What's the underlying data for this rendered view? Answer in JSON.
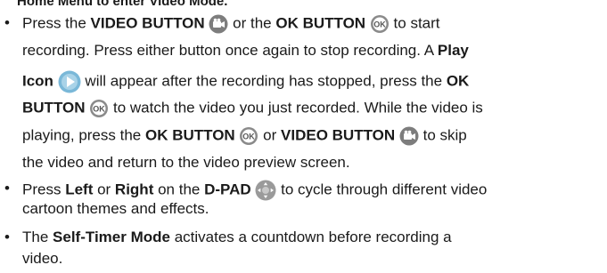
{
  "heading": "Home Menu to enter Video Mode.",
  "icons": {
    "video_button": "video-camera-icon",
    "ok_button": "ok-button-icon",
    "play": "play-icon",
    "dpad": "d-pad-icon"
  },
  "colors": {
    "video_icon_bg": "#7d7d7d",
    "ok_icon_ring": "#8a8a8a",
    "play_icon": "#7ab8d8",
    "dpad_icon": "#9a9a9a"
  },
  "bullet1": {
    "l1a": "Press the ",
    "l1b": "VIDEO BUTTON",
    "l1c": " or the ",
    "l1d": "OK BUTTON",
    "l1e": " to start",
    "l2": "recording. Press either button once again to stop recording. A ",
    "l2b": "Play",
    "l3a": "Icon",
    "l3b": " will appear after the recording has stopped, press the ",
    "l3c": "OK",
    "l4a": "BUTTON",
    "l4b": " to watch the video you just recorded. While the video is",
    "l5a": "playing, press the ",
    "l5b": "OK BUTTON",
    "l5c": " or ",
    "l5d": "VIDEO BUTTON",
    "l5e": " to skip",
    "l6": "the video and return to the video preview screen."
  },
  "bullet2": {
    "l1a": "Press ",
    "l1b": "Left",
    "l1c": " or ",
    "l1d": "Right",
    "l1e": " on the ",
    "l1f": "D-PAD",
    "l1g": " to cycle through different video",
    "l2": "cartoon themes and effects."
  },
  "bullet3": {
    "l1a": "The ",
    "l1b": "Self-Timer Mode",
    "l1c": " activates a countdown before recording a",
    "l2": "video."
  },
  "ok_label": "OK"
}
